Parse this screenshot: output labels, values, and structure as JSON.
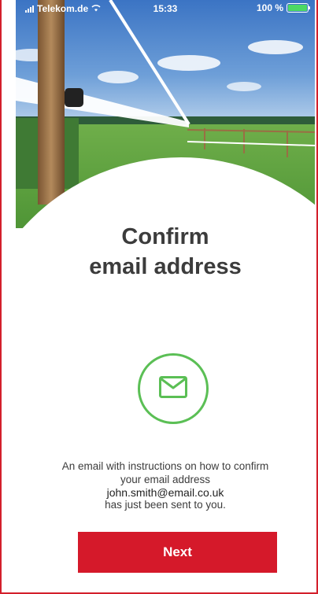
{
  "status_bar": {
    "carrier": "Telekom.de",
    "time": "15:33",
    "battery": "100 %",
    "battery_level": 1.0
  },
  "hero": {
    "illustration": "electric-fence-pasture"
  },
  "title": {
    "line1": "Confirm",
    "line2": "email address"
  },
  "icon": {
    "name": "envelope-icon",
    "color": "#5bbf55"
  },
  "message": {
    "line1": "An email with instructions on how to confirm",
    "line2": "your email address",
    "email": "john.smith@email.co.uk",
    "line3": "has just been sent to you."
  },
  "next_button": {
    "label": "Next",
    "color": "#d5192a"
  }
}
